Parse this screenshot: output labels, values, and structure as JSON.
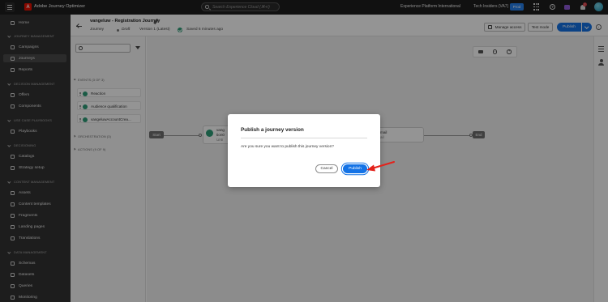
{
  "app": {
    "title": "Adobe Journey Optimizer"
  },
  "search": {
    "placeholder": "Search Experience Cloud (⌘+/)"
  },
  "topbar": {
    "org": "Experience Platform International",
    "sandbox": "Tech Insiders (VA7)",
    "env_badge": "Prod",
    "notifications": "7"
  },
  "sidebar": {
    "home": "Home",
    "sections": {
      "journey_management": "JOURNEY MANAGEMENT",
      "decision_management": "DECISION MANAGEMENT",
      "use_case_playbooks": "USE CASE PLAYBOOKS",
      "decisioning": "DECISIONING",
      "content_management": "CONTENT MANAGEMENT",
      "data_management": "DATA MANAGEMENT"
    },
    "items": {
      "campaigns": "Campaigns",
      "journeys": "Journeys",
      "reports": "Reports",
      "offers": "Offers",
      "components": "Components",
      "playbooks": "Playbooks",
      "catalogs": "Catalogs",
      "strategy_setup": "Strategy setup",
      "assets": "Assets",
      "content_templates": "Content templates",
      "fragments": "Fragments",
      "landing_pages": "Landing pages",
      "translations": "Translations",
      "schemas": "Schemas",
      "datasets": "Datasets",
      "queries": "Queries",
      "monitoring": "Monitoring"
    }
  },
  "journey": {
    "title": "vangeluw - Registration Journey",
    "type": "Journey",
    "status": "Draft",
    "version": "Version 1 (Latest)",
    "saved": "Saved 6 minutes ago"
  },
  "header_actions": {
    "manage_access": "Manage access",
    "test_mode": "Test mode",
    "publish": "Publish"
  },
  "palette": {
    "events_section": "EVENTS (3 OF 3)",
    "events": [
      "Reaction",
      "Audience qualification",
      "vangeluwAccountCrea..."
    ],
    "orchestration_section": "ORCHESTRATION (3)",
    "actions_section": "ACTIONS (9 OF 9)"
  },
  "canvas": {
    "start": "Start",
    "end": "End",
    "node1_line1": "vang",
    "node1_line2": "tion0",
    "node1_line3": "Unti",
    "node2_line1": "mail",
    "node2_line2": "ail"
  },
  "dialog": {
    "title": "Publish a journey version",
    "body": "Are you sure you want to publish this journey version?",
    "cancel": "Cancel",
    "publish": "Publish"
  },
  "colors": {
    "accent": "#1473e6",
    "adobe_red": "#eb1000",
    "success": "#2d9d78",
    "annotation": "#e3221b"
  }
}
